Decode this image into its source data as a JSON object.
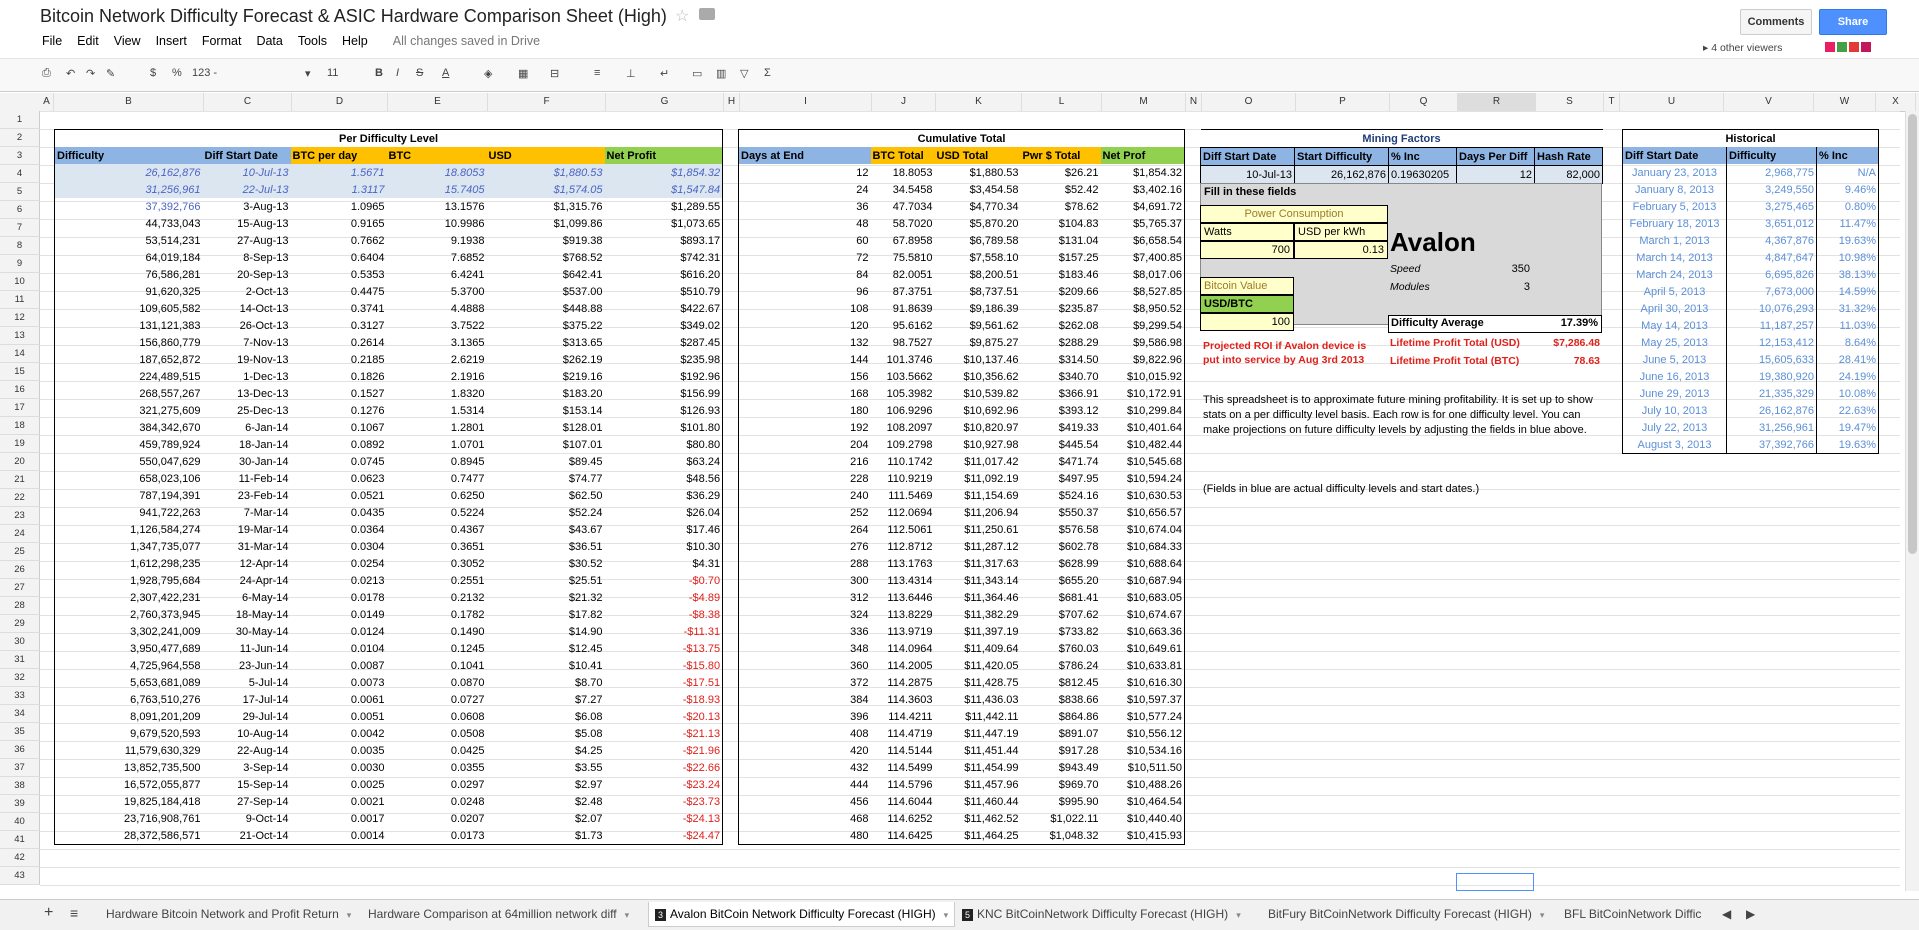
{
  "title": "Bitcoin Network Difficulty Forecast & ASIC Hardware Comparison Sheet (High)",
  "menu": [
    "File",
    "Edit",
    "View",
    "Insert",
    "Format",
    "Data",
    "Tools",
    "Help"
  ],
  "saved": "All changes saved in Drive",
  "comments_label": "Comments",
  "share_label": "Share",
  "viewers": "4 other viewers",
  "viewer_colors": [
    "#e91e63",
    "#43a047",
    "#e53935",
    "#c2185b"
  ],
  "toolbar": {
    "currency": "$",
    "percent": "%",
    "more_formats": "123 -",
    "font_size": "11",
    "bold": "B",
    "italic": "I",
    "strike": "S",
    "textcolor": "A",
    "func": "Σ"
  },
  "columns": [
    "A",
    "B",
    "C",
    "D",
    "E",
    "F",
    "G",
    "H",
    "I",
    "J",
    "K",
    "L",
    "M",
    "N",
    "O",
    "P",
    "Q",
    "R",
    "S",
    "T",
    "U",
    "V",
    "W",
    "X"
  ],
  "rows": [
    "1",
    "2",
    "3",
    "4",
    "5",
    "6",
    "7",
    "8",
    "9",
    "10",
    "11",
    "12",
    "13",
    "14",
    "15",
    "16",
    "17",
    "18",
    "19",
    "20",
    "21",
    "22",
    "23",
    "24",
    "25",
    "26",
    "27",
    "28",
    "29",
    "30",
    "31",
    "32",
    "33",
    "34",
    "35",
    "36",
    "37",
    "38",
    "39",
    "40",
    "41",
    "42",
    "43"
  ],
  "per_diff": {
    "title": "Per Difficulty Level",
    "headers": [
      "Difficulty",
      "Diff Start Date",
      "BTC per day",
      "BTC",
      "USD",
      "Net Profit"
    ],
    "rows": [
      [
        "26,162,876",
        "10-Jul-13",
        "1.5671",
        "18.8053",
        "$1,880.53",
        "$1,854.32"
      ],
      [
        "31,256,961",
        "22-Jul-13",
        "1.3117",
        "15.7405",
        "$1,574.05",
        "$1,547.84"
      ],
      [
        "37,392,766",
        "3-Aug-13",
        "1.0965",
        "13.1576",
        "$1,315.76",
        "$1,289.55"
      ],
      [
        "44,733,043",
        "15-Aug-13",
        "0.9165",
        "10.9986",
        "$1,099.86",
        "$1,073.65"
      ],
      [
        "53,514,231",
        "27-Aug-13",
        "0.7662",
        "9.1938",
        "$919.38",
        "$893.17"
      ],
      [
        "64,019,184",
        "8-Sep-13",
        "0.6404",
        "7.6852",
        "$768.52",
        "$742.31"
      ],
      [
        "76,586,281",
        "20-Sep-13",
        "0.5353",
        "6.4241",
        "$642.41",
        "$616.20"
      ],
      [
        "91,620,325",
        "2-Oct-13",
        "0.4475",
        "5.3700",
        "$537.00",
        "$510.79"
      ],
      [
        "109,605,582",
        "14-Oct-13",
        "0.3741",
        "4.4888",
        "$448.88",
        "$422.67"
      ],
      [
        "131,121,383",
        "26-Oct-13",
        "0.3127",
        "3.7522",
        "$375.22",
        "$349.02"
      ],
      [
        "156,860,779",
        "7-Nov-13",
        "0.2614",
        "3.1365",
        "$313.65",
        "$287.45"
      ],
      [
        "187,652,872",
        "19-Nov-13",
        "0.2185",
        "2.6219",
        "$262.19",
        "$235.98"
      ],
      [
        "224,489,515",
        "1-Dec-13",
        "0.1826",
        "2.1916",
        "$219.16",
        "$192.96"
      ],
      [
        "268,557,267",
        "13-Dec-13",
        "0.1527",
        "1.8320",
        "$183.20",
        "$156.99"
      ],
      [
        "321,275,609",
        "25-Dec-13",
        "0.1276",
        "1.5314",
        "$153.14",
        "$126.93"
      ],
      [
        "384,342,670",
        "6-Jan-14",
        "0.1067",
        "1.2801",
        "$128.01",
        "$101.80"
      ],
      [
        "459,789,924",
        "18-Jan-14",
        "0.0892",
        "1.0701",
        "$107.01",
        "$80.80"
      ],
      [
        "550,047,629",
        "30-Jan-14",
        "0.0745",
        "0.8945",
        "$89.45",
        "$63.24"
      ],
      [
        "658,023,106",
        "11-Feb-14",
        "0.0623",
        "0.7477",
        "$74.77",
        "$48.56"
      ],
      [
        "787,194,391",
        "23-Feb-14",
        "0.0521",
        "0.6250",
        "$62.50",
        "$36.29"
      ],
      [
        "941,722,263",
        "7-Mar-14",
        "0.0435",
        "0.5224",
        "$52.24",
        "$26.04"
      ],
      [
        "1,126,584,274",
        "19-Mar-14",
        "0.0364",
        "0.4367",
        "$43.67",
        "$17.46"
      ],
      [
        "1,347,735,077",
        "31-Mar-14",
        "0.0304",
        "0.3651",
        "$36.51",
        "$10.30"
      ],
      [
        "1,612,298,235",
        "12-Apr-14",
        "0.0254",
        "0.3052",
        "$30.52",
        "$4.31"
      ],
      [
        "1,928,795,684",
        "24-Apr-14",
        "0.0213",
        "0.2551",
        "$25.51",
        "-$0.70"
      ],
      [
        "2,307,422,231",
        "6-May-14",
        "0.0178",
        "0.2132",
        "$21.32",
        "-$4.89"
      ],
      [
        "2,760,373,945",
        "18-May-14",
        "0.0149",
        "0.1782",
        "$17.82",
        "-$8.38"
      ],
      [
        "3,302,241,009",
        "30-May-14",
        "0.0124",
        "0.1490",
        "$14.90",
        "-$11.31"
      ],
      [
        "3,950,477,689",
        "11-Jun-14",
        "0.0104",
        "0.1245",
        "$12.45",
        "-$13.75"
      ],
      [
        "4,725,964,558",
        "23-Jun-14",
        "0.0087",
        "0.1041",
        "$10.41",
        "-$15.80"
      ],
      [
        "5,653,681,089",
        "5-Jul-14",
        "0.0073",
        "0.0870",
        "$8.70",
        "-$17.51"
      ],
      [
        "6,763,510,276",
        "17-Jul-14",
        "0.0061",
        "0.0727",
        "$7.27",
        "-$18.93"
      ],
      [
        "8,091,201,209",
        "29-Jul-14",
        "0.0051",
        "0.0608",
        "$6.08",
        "-$20.13"
      ],
      [
        "9,679,520,593",
        "10-Aug-14",
        "0.0042",
        "0.0508",
        "$5.08",
        "-$21.13"
      ],
      [
        "11,579,630,329",
        "22-Aug-14",
        "0.0035",
        "0.0425",
        "$4.25",
        "-$21.96"
      ],
      [
        "13,852,735,500",
        "3-Sep-14",
        "0.0030",
        "0.0355",
        "$3.55",
        "-$22.66"
      ],
      [
        "16,572,055,877",
        "15-Sep-14",
        "0.0025",
        "0.0297",
        "$2.97",
        "-$23.24"
      ],
      [
        "19,825,184,418",
        "27-Sep-14",
        "0.0021",
        "0.0248",
        "$2.48",
        "-$23.73"
      ],
      [
        "23,716,908,761",
        "9-Oct-14",
        "0.0017",
        "0.0207",
        "$2.07",
        "-$24.13"
      ],
      [
        "28,372,586,571",
        "21-Oct-14",
        "0.0014",
        "0.0173",
        "$1.73",
        "-$24.47"
      ]
    ]
  },
  "cumulative": {
    "title": "Cumulative Total",
    "headers": [
      "Days at End",
      "BTC Total",
      "USD Total",
      "Pwr $ Total",
      "Net Prof"
    ],
    "rows": [
      [
        "12",
        "18.8053",
        "$1,880.53",
        "$26.21",
        "$1,854.32"
      ],
      [
        "24",
        "34.5458",
        "$3,454.58",
        "$52.42",
        "$3,402.16"
      ],
      [
        "36",
        "47.7034",
        "$4,770.34",
        "$78.62",
        "$4,691.72"
      ],
      [
        "48",
        "58.7020",
        "$5,870.20",
        "$104.83",
        "$5,765.37"
      ],
      [
        "60",
        "67.8958",
        "$6,789.58",
        "$131.04",
        "$6,658.54"
      ],
      [
        "72",
        "75.5810",
        "$7,558.10",
        "$157.25",
        "$7,400.85"
      ],
      [
        "84",
        "82.0051",
        "$8,200.51",
        "$183.46",
        "$8,017.06"
      ],
      [
        "96",
        "87.3751",
        "$8,737.51",
        "$209.66",
        "$8,527.85"
      ],
      [
        "108",
        "91.8639",
        "$9,186.39",
        "$235.87",
        "$8,950.52"
      ],
      [
        "120",
        "95.6162",
        "$9,561.62",
        "$262.08",
        "$9,299.54"
      ],
      [
        "132",
        "98.7527",
        "$9,875.27",
        "$288.29",
        "$9,586.98"
      ],
      [
        "144",
        "101.3746",
        "$10,137.46",
        "$314.50",
        "$9,822.96"
      ],
      [
        "156",
        "103.5662",
        "$10,356.62",
        "$340.70",
        "$10,015.92"
      ],
      [
        "168",
        "105.3982",
        "$10,539.82",
        "$366.91",
        "$10,172.91"
      ],
      [
        "180",
        "106.9296",
        "$10,692.96",
        "$393.12",
        "$10,299.84"
      ],
      [
        "192",
        "108.2097",
        "$10,820.97",
        "$419.33",
        "$10,401.64"
      ],
      [
        "204",
        "109.2798",
        "$10,927.98",
        "$445.54",
        "$10,482.44"
      ],
      [
        "216",
        "110.1742",
        "$11,017.42",
        "$471.74",
        "$10,545.68"
      ],
      [
        "228",
        "110.9219",
        "$11,092.19",
        "$497.95",
        "$10,594.24"
      ],
      [
        "240",
        "111.5469",
        "$11,154.69",
        "$524.16",
        "$10,630.53"
      ],
      [
        "252",
        "112.0694",
        "$11,206.94",
        "$550.37",
        "$10,656.57"
      ],
      [
        "264",
        "112.5061",
        "$11,250.61",
        "$576.58",
        "$10,674.04"
      ],
      [
        "276",
        "112.8712",
        "$11,287.12",
        "$602.78",
        "$10,684.33"
      ],
      [
        "288",
        "113.1763",
        "$11,317.63",
        "$628.99",
        "$10,688.64"
      ],
      [
        "300",
        "113.4314",
        "$11,343.14",
        "$655.20",
        "$10,687.94"
      ],
      [
        "312",
        "113.6446",
        "$11,364.46",
        "$681.41",
        "$10,683.05"
      ],
      [
        "324",
        "113.8229",
        "$11,382.29",
        "$707.62",
        "$10,674.67"
      ],
      [
        "336",
        "113.9719",
        "$11,397.19",
        "$733.82",
        "$10,663.36"
      ],
      [
        "348",
        "114.0964",
        "$11,409.64",
        "$760.03",
        "$10,649.61"
      ],
      [
        "360",
        "114.2005",
        "$11,420.05",
        "$786.24",
        "$10,633.81"
      ],
      [
        "372",
        "114.2875",
        "$11,428.75",
        "$812.45",
        "$10,616.30"
      ],
      [
        "384",
        "114.3603",
        "$11,436.03",
        "$838.66",
        "$10,597.37"
      ],
      [
        "396",
        "114.4211",
        "$11,442.11",
        "$864.86",
        "$10,577.24"
      ],
      [
        "408",
        "114.4719",
        "$11,447.19",
        "$891.07",
        "$10,556.12"
      ],
      [
        "420",
        "114.5144",
        "$11,451.44",
        "$917.28",
        "$10,534.16"
      ],
      [
        "432",
        "114.5499",
        "$11,454.99",
        "$943.49",
        "$10,511.50"
      ],
      [
        "444",
        "114.5796",
        "$11,457.96",
        "$969.70",
        "$10,488.26"
      ],
      [
        "456",
        "114.6044",
        "$11,460.44",
        "$995.90",
        "$10,464.54"
      ],
      [
        "468",
        "114.6252",
        "$11,462.52",
        "$1,022.11",
        "$10,440.40"
      ],
      [
        "480",
        "114.6425",
        "$11,464.25",
        "$1,048.32",
        "$10,415.93"
      ]
    ]
  },
  "mining": {
    "title": "Mining Factors",
    "headers": [
      "Diff Start Date",
      "Start Difficulty",
      "% Inc",
      "Days Per Diff",
      "Hash Rate"
    ],
    "values": [
      "10-Jul-13",
      "26,162,876",
      "0.19630205",
      "12",
      "82,000"
    ],
    "fill_label": "Fill in these fields",
    "power_title": "Power Consumption",
    "watts_label": "Watts",
    "kwh_label": "USD per kWh",
    "watts": "700",
    "kwh": "0.13",
    "btc_value_label": "Bitcoin Value",
    "usd_btc_label": "USD/BTC",
    "usd_btc": "100",
    "device": "Avalon",
    "speed_label": "Speed",
    "speed": "350",
    "modules_label": "Modules",
    "modules": "3",
    "diff_avg_label": "Difficulty Average",
    "diff_avg": "17.39%",
    "roi_text": "Projected ROI if Avalon device is put into service by Aug 3rd 2013",
    "lifetime_usd_label": "Lifetime Profit Total (USD)",
    "lifetime_usd": "$7,286.48",
    "lifetime_btc_label": "Lifetime Profit Total (BTC)",
    "lifetime_btc": "78.63",
    "note1": "This spreadsheet is to approximate future mining profitability. It is set up to show stats on a per difficulty level basis. Each row is for one difficulty level. You can make projections on future difficulty levels by adjusting the fields in blue above.",
    "note2": "(Fields in blue are actual difficulty levels and start dates.)"
  },
  "historical": {
    "title": "Historical",
    "headers": [
      "Diff Start Date",
      "Difficulty",
      "% Inc"
    ],
    "rows": [
      [
        "January 23, 2013",
        "2,968,775",
        "N/A"
      ],
      [
        "January 8, 2013",
        "3,249,550",
        "9.46%"
      ],
      [
        "February 5, 2013",
        "3,275,465",
        "0.80%"
      ],
      [
        "February 18, 2013",
        "3,651,012",
        "11.47%"
      ],
      [
        "March 1, 2013",
        "4,367,876",
        "19.63%"
      ],
      [
        "March 14, 2013",
        "4,847,647",
        "10.98%"
      ],
      [
        "March 24, 2013",
        "6,695,826",
        "38.13%"
      ],
      [
        "April 5, 2013",
        "7,673,000",
        "14.59%"
      ],
      [
        "April 30, 2013",
        "10,076,293",
        "31.32%"
      ],
      [
        "May 14, 2013",
        "11,187,257",
        "11.03%"
      ],
      [
        "May 25, 2013",
        "12,153,412",
        "8.64%"
      ],
      [
        "June 5, 2013",
        "15,605,633",
        "28.41%"
      ],
      [
        "June 16, 2013",
        "19,380,920",
        "24.19%"
      ],
      [
        "June 29, 2013",
        "21,335,329",
        "10.08%"
      ],
      [
        "July 10, 2013",
        "26,162,876",
        "22.63%"
      ],
      [
        "July 22, 2013",
        "31,256,961",
        "19.47%"
      ],
      [
        "August 3, 2013",
        "37,392,766",
        "19.63%"
      ]
    ]
  },
  "tabs": [
    {
      "label": "Hardware Bitcoin Network and Profit Return"
    },
    {
      "label": "Hardware Comparison at 64million network diff"
    },
    {
      "label": "Avalon BitCoin Network Difficulty Forecast (HIGH)",
      "badge": "3"
    },
    {
      "label": "KNC BitCoinNetwork Difficulty Forecast (HIGH)",
      "badge": "5"
    },
    {
      "label": "BitFury BitCoinNetwork Difficulty Forecast (HIGH)"
    },
    {
      "label": "BFL BitCoinNetwork Diffic"
    }
  ],
  "colors": {
    "hdr_blue": "#8db4e2",
    "hdr_orange": "#ffc000",
    "hdr_green": "#92d050",
    "input_yellow": "#ffffcc",
    "panel_grey": "#d9d9d9",
    "neg_red": "#e0201b",
    "link_blue": "#4a64c4"
  }
}
